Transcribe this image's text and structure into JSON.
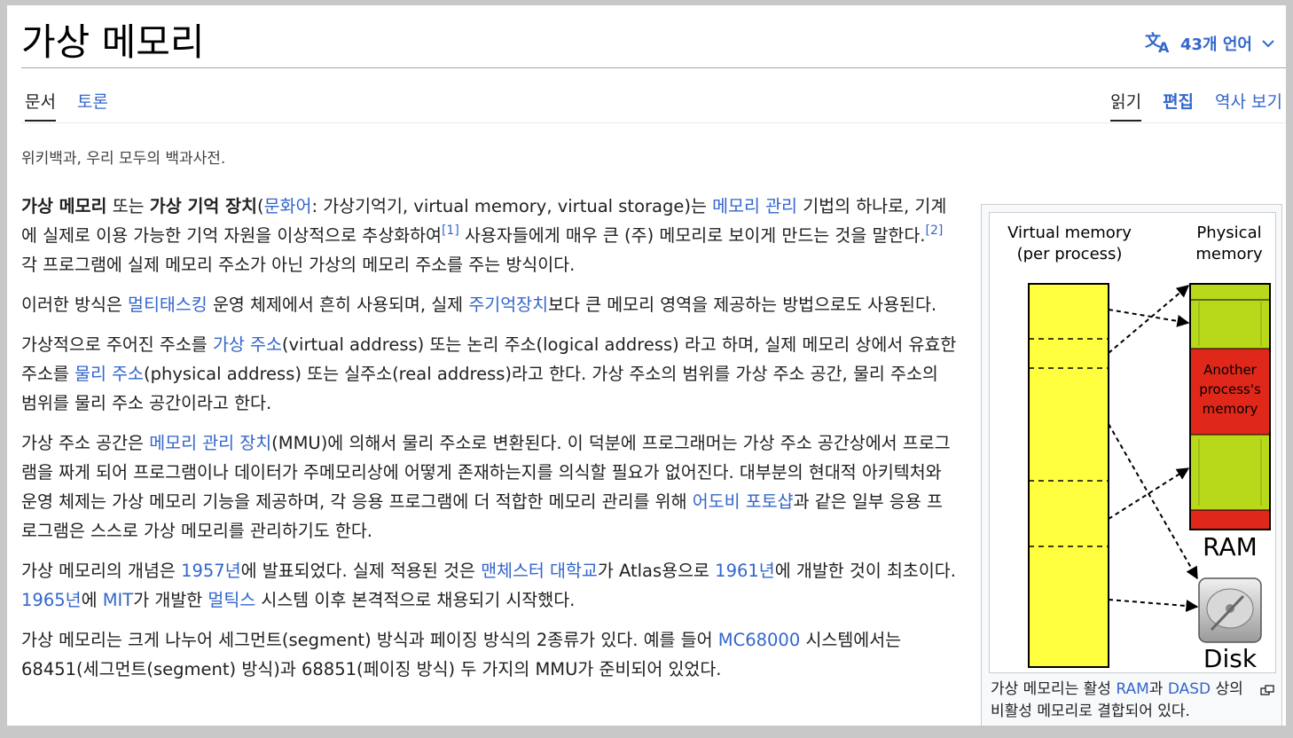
{
  "article": {
    "title": "가상 메모리",
    "languages_label": "43개 언어",
    "site_sub": "위키백과, 우리 모두의 백과사전."
  },
  "tabs": {
    "article": "문서",
    "talk": "토론",
    "read": "읽기",
    "edit": "편집",
    "history": "역사 보기"
  },
  "paragraphs": {
    "p1": {
      "term1": "가상 메모리",
      "t1": " 또는 ",
      "term2": "가상 기억 장치",
      "t2": "(",
      "link_lang": "문화어",
      "t3": ": 가상기억기, virtual memory, virtual storage)는 ",
      "link_mm": "메모리 관리",
      "t4": " 기법의 하나로, 기계에 실제로 이용 가능한 기억 자원을 이상적으로 추상화하여",
      "ref1": "[1]",
      "t5": " 사용자들에게 매우 큰 (주) 메모리로 보이게 만드는 것을 말한다.",
      "ref2": "[2]",
      "t6": " 각 프로그램에 실제 메모리 주소가 아닌 가상의 메모리 주소를 주는 방식이다."
    },
    "p2": {
      "t1": "이러한 방식은 ",
      "link_mt": "멀티태스킹",
      "t2": " 운영 체제에서 흔히 사용되며, 실제 ",
      "link_main": "주기억장치",
      "t3": "보다 큰 메모리 영역을 제공하는 방법으로도 사용된다."
    },
    "p3": {
      "t1": "가상적으로 주어진 주소를 ",
      "link_va": "가상 주소",
      "t2": "(virtual address) 또는 논리 주소(logical address) 라고 하며, 실제 메모리 상에서 유효한 주소를 ",
      "link_pa": "물리 주소",
      "t3": "(physical address) 또는 실주소(real address)라고 한다. 가상 주소의 범위를 가상 주소 공간, 물리 주소의 범위를 물리 주소 공간이라고 한다."
    },
    "p4": {
      "t1": "가상 주소 공간은 ",
      "link_mmu": "메모리 관리 장치",
      "t2": "(MMU)에 의해서 물리 주소로 변환된다. 이 덕분에 프로그래머는 가상 주소 공간상에서 프로그램을 짜게 되어 프로그램이나 데이터가 주메모리상에 어떻게 존재하는지를 의식할 필요가 없어진다. 대부분의 현대적 아키텍처와 운영 체제는 가상 메모리 기능을 제공하며, 각 응용 프로그램에 더 적합한 메모리 관리를 위해 ",
      "link_ps": "어도비 포토샵",
      "t3": "과 같은 일부 응용 프로그램은 스스로 가상 메모리를 관리하기도 한다."
    },
    "p5": {
      "t1": "가상 메모리의 개념은 ",
      "link_1957": "1957년",
      "t2": "에 발표되었다. 실제 적용된 것은 ",
      "link_manchester": "맨체스터 대학교",
      "t3": "가 Atlas용으로 ",
      "link_1961": "1961년",
      "t4": "에 개발한 것이 최초이다. ",
      "link_1965": "1965년",
      "t5": "에 ",
      "link_mit": "MIT",
      "t6": "가 개발한 ",
      "link_multics": "멀틱스",
      "t7": " 시스템 이후 본격적으로 채용되기 시작했다."
    },
    "p6": {
      "t1": "가상 메모리는 크게 나누어 세그먼트(segment) 방식과 페이징 방식의 2종류가 있다. 예를 들어 ",
      "link_mc": "MC68000",
      "t2": " 시스템에서는 68451(세그먼트(segment) 방식)과 68851(페이징 방식) 두 가지의 MMU가 준비되어 있었다."
    }
  },
  "figure": {
    "label_virtual_line1": "Virtual memory",
    "label_virtual_line2": "(per process)",
    "label_physical_line1": "Physical",
    "label_physical_line2": "memory",
    "label_another_1": "Another",
    "label_another_2": "process's",
    "label_another_3": "memory",
    "label_ram": "RAM",
    "label_disk": "Disk",
    "colors": {
      "virtual_fill": "#ffff40",
      "ram_green": "#b8d81a",
      "ram_red": "#e0281a"
    },
    "caption": {
      "t1": "가상 메모리는 활성 ",
      "link_ram": "RAM",
      "t2": "과 ",
      "link_dasd": "DASD",
      "t3": " 상의 비활성 메모리로 결합되어 있다."
    },
    "icons": [
      "translate-icon",
      "chevron-down-icon",
      "magnify-icon",
      "hard-disk-icon"
    ]
  }
}
